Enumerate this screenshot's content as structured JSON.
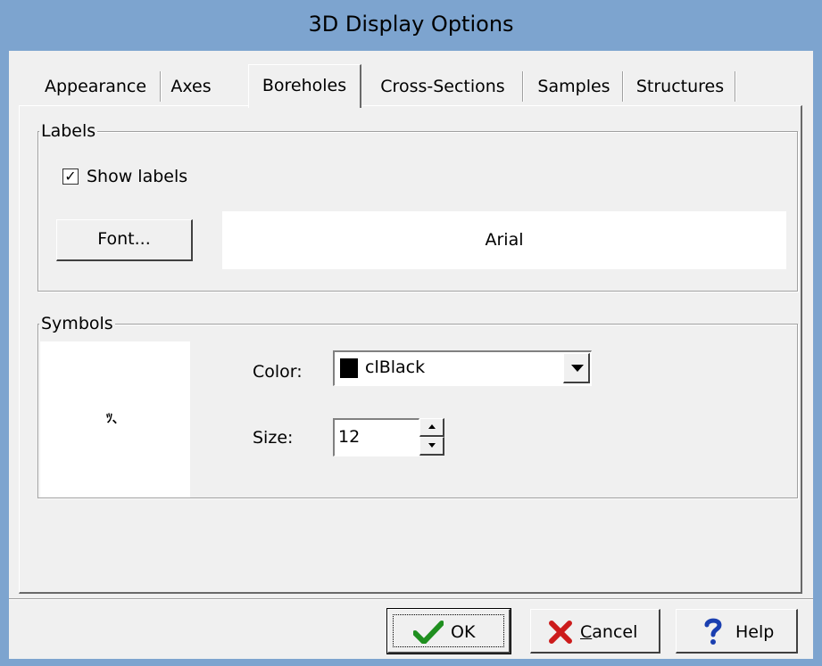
{
  "window": {
    "title": "3D Display Options"
  },
  "tabs": [
    {
      "label": "Appearance",
      "active": false
    },
    {
      "label": "Axes",
      "active": false
    },
    {
      "label": "Boreholes",
      "active": true
    },
    {
      "label": "Cross-Sections",
      "active": false
    },
    {
      "label": "Samples",
      "active": false
    },
    {
      "label": "Structures",
      "active": false
    }
  ],
  "labels_group": {
    "caption": "Labels",
    "show_labels": {
      "label": "Show labels",
      "checked": true,
      "check_glyph": "✓"
    },
    "font_button": "Font...",
    "font_preview": "Arial"
  },
  "symbols_group": {
    "caption": "Symbols",
    "preview_glyph": "ﾂ､",
    "color_label": "Color:",
    "color_value": "clBlack",
    "color_swatch": "#000000",
    "size_label": "Size:",
    "size_value": "12"
  },
  "buttons": {
    "ok": {
      "label": "OK",
      "icon": "check-icon"
    },
    "cancel": {
      "label": "Cancel",
      "accel": "C",
      "rest": "ancel",
      "icon": "close-icon"
    },
    "help": {
      "label": "Help",
      "icon": "help-icon"
    }
  },
  "colors": {
    "titlebar": "#7da4cf",
    "face": "#f0f0f0",
    "ok_check": "#1f8f1f",
    "cancel_x": "#cc1b1b",
    "help_q": "#1a3fb0"
  }
}
